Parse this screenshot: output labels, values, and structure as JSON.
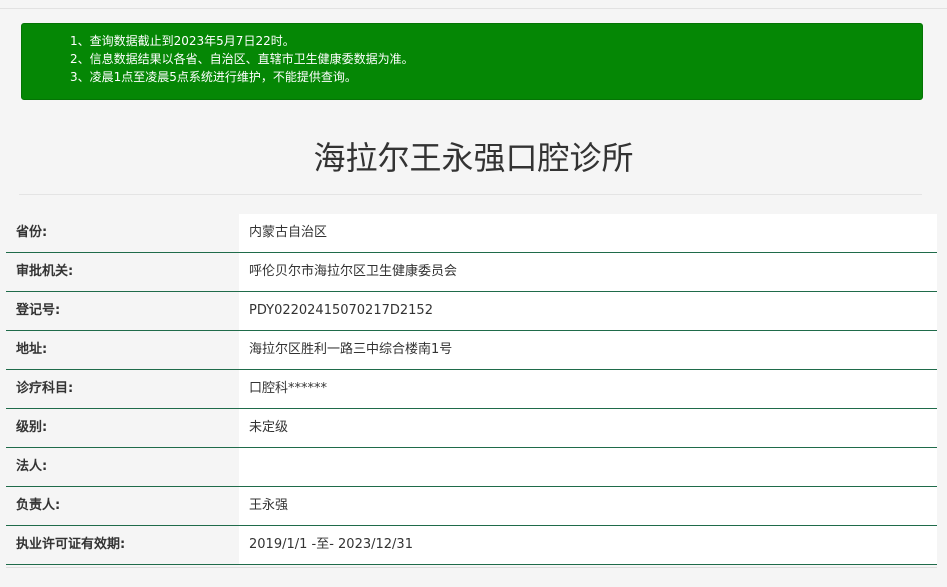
{
  "notice": {
    "lines": [
      "1、查询数据截止到2023年5月7日22时。",
      "2、信息数据结果以各省、自治区、直辖市卫生健康委数据为准。",
      "3、凌晨1点至凌晨5点系统进行维护，不能提供查询。"
    ],
    "color": "#058705"
  },
  "title": "海拉尔王永强口腔诊所",
  "fields": [
    {
      "label": "省份:",
      "value": "内蒙古自治区"
    },
    {
      "label": "审批机关:",
      "value": "呼伦贝尔市海拉尔区卫生健康委员会"
    },
    {
      "label": "登记号:",
      "value": "PDY02202415070217D2152"
    },
    {
      "label": "地址:",
      "value": "海拉尔区胜利一路三中综合楼南1号"
    },
    {
      "label": "诊疗科目:",
      "value": "口腔科******"
    },
    {
      "label": "级别:",
      "value": "未定级"
    },
    {
      "label": "法人:",
      "value": ""
    },
    {
      "label": "负责人:",
      "value": "王永强"
    },
    {
      "label": "执业许可证有效期:",
      "value": "2019/1/1 -至- 2023/12/31"
    }
  ],
  "colors": {
    "row_divider": "#1f6b4a",
    "page_background": "#f5f5f5"
  }
}
